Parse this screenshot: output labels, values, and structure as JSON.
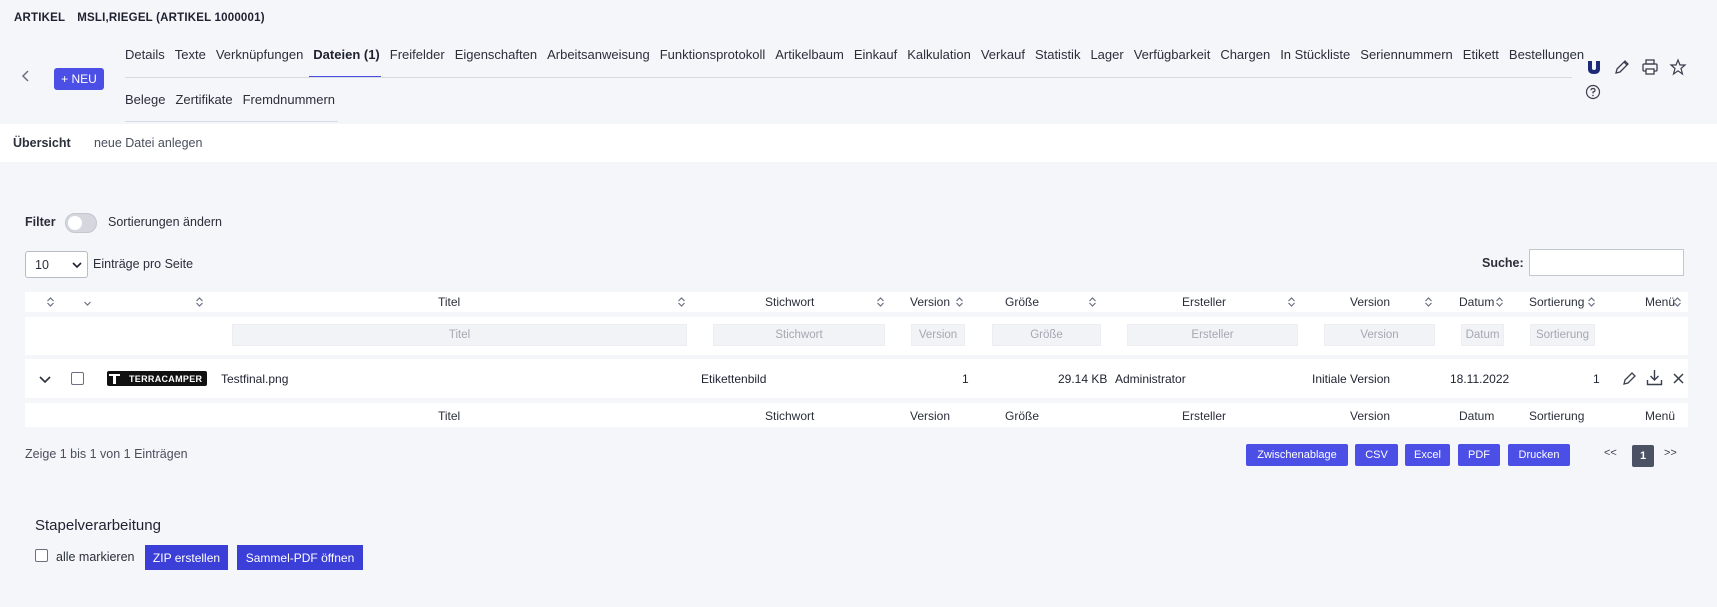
{
  "header": {
    "section": "ARTIKEL",
    "title": "MSLI,RIEGEL (ARTIKEL 1000001)",
    "new_button": "+ NEU"
  },
  "tabs": [
    "Details",
    "Texte",
    "Verknüpfungen",
    "Dateien (1)",
    "Freifelder",
    "Eigenschaften",
    "Arbeitsanweisung",
    "Funktionsprotokoll",
    "Artikelbaum",
    "Einkauf",
    "Kalkulation",
    "Verkauf",
    "Statistik",
    "Lager",
    "Verfügbarkeit",
    "Chargen",
    "In Stückliste",
    "Seriennummern",
    "Etikett",
    "Bestellungen"
  ],
  "tabs2": [
    "Belege",
    "Zertifikate",
    "Fremdnummern"
  ],
  "active_tab": "Dateien (1)",
  "subnav": {
    "overview": "Übersicht",
    "new_file": "neue Datei anlegen"
  },
  "filter": {
    "label": "Filter",
    "sort_label": "Sortierungen ändern"
  },
  "page_size": {
    "value": "10",
    "label": "Einträge pro Seite"
  },
  "search": {
    "label": "Suche:",
    "value": ""
  },
  "columns": {
    "titel": "Titel",
    "stichwort": "Stichwort",
    "version": "Version",
    "groesse": "Größe",
    "ersteller": "Ersteller",
    "version2": "Version",
    "datum": "Datum",
    "sortierung": "Sortierung",
    "menu": "Menü"
  },
  "row": {
    "logo_text": "TERRACAMPER",
    "titel": "Testfinal.png",
    "stichwort": "Etikettenbild",
    "version": "1",
    "groesse": "29.14 KB",
    "ersteller": "Administrator",
    "version2": "Initiale Version",
    "datum": "18.11.2022",
    "sortierung": "1"
  },
  "info": "Zeige 1 bis 1 von 1 Einträgen",
  "export": [
    "Zwischenablage",
    "CSV",
    "Excel",
    "PDF",
    "Drucken"
  ],
  "pagination": {
    "prev": "<<",
    "current": "1",
    "next": ">>"
  },
  "batch": {
    "title": "Stapelverarbeitung",
    "select_all": "alle markieren",
    "zip": "ZIP erstellen",
    "pdf": "Sammel-PDF öffnen"
  }
}
